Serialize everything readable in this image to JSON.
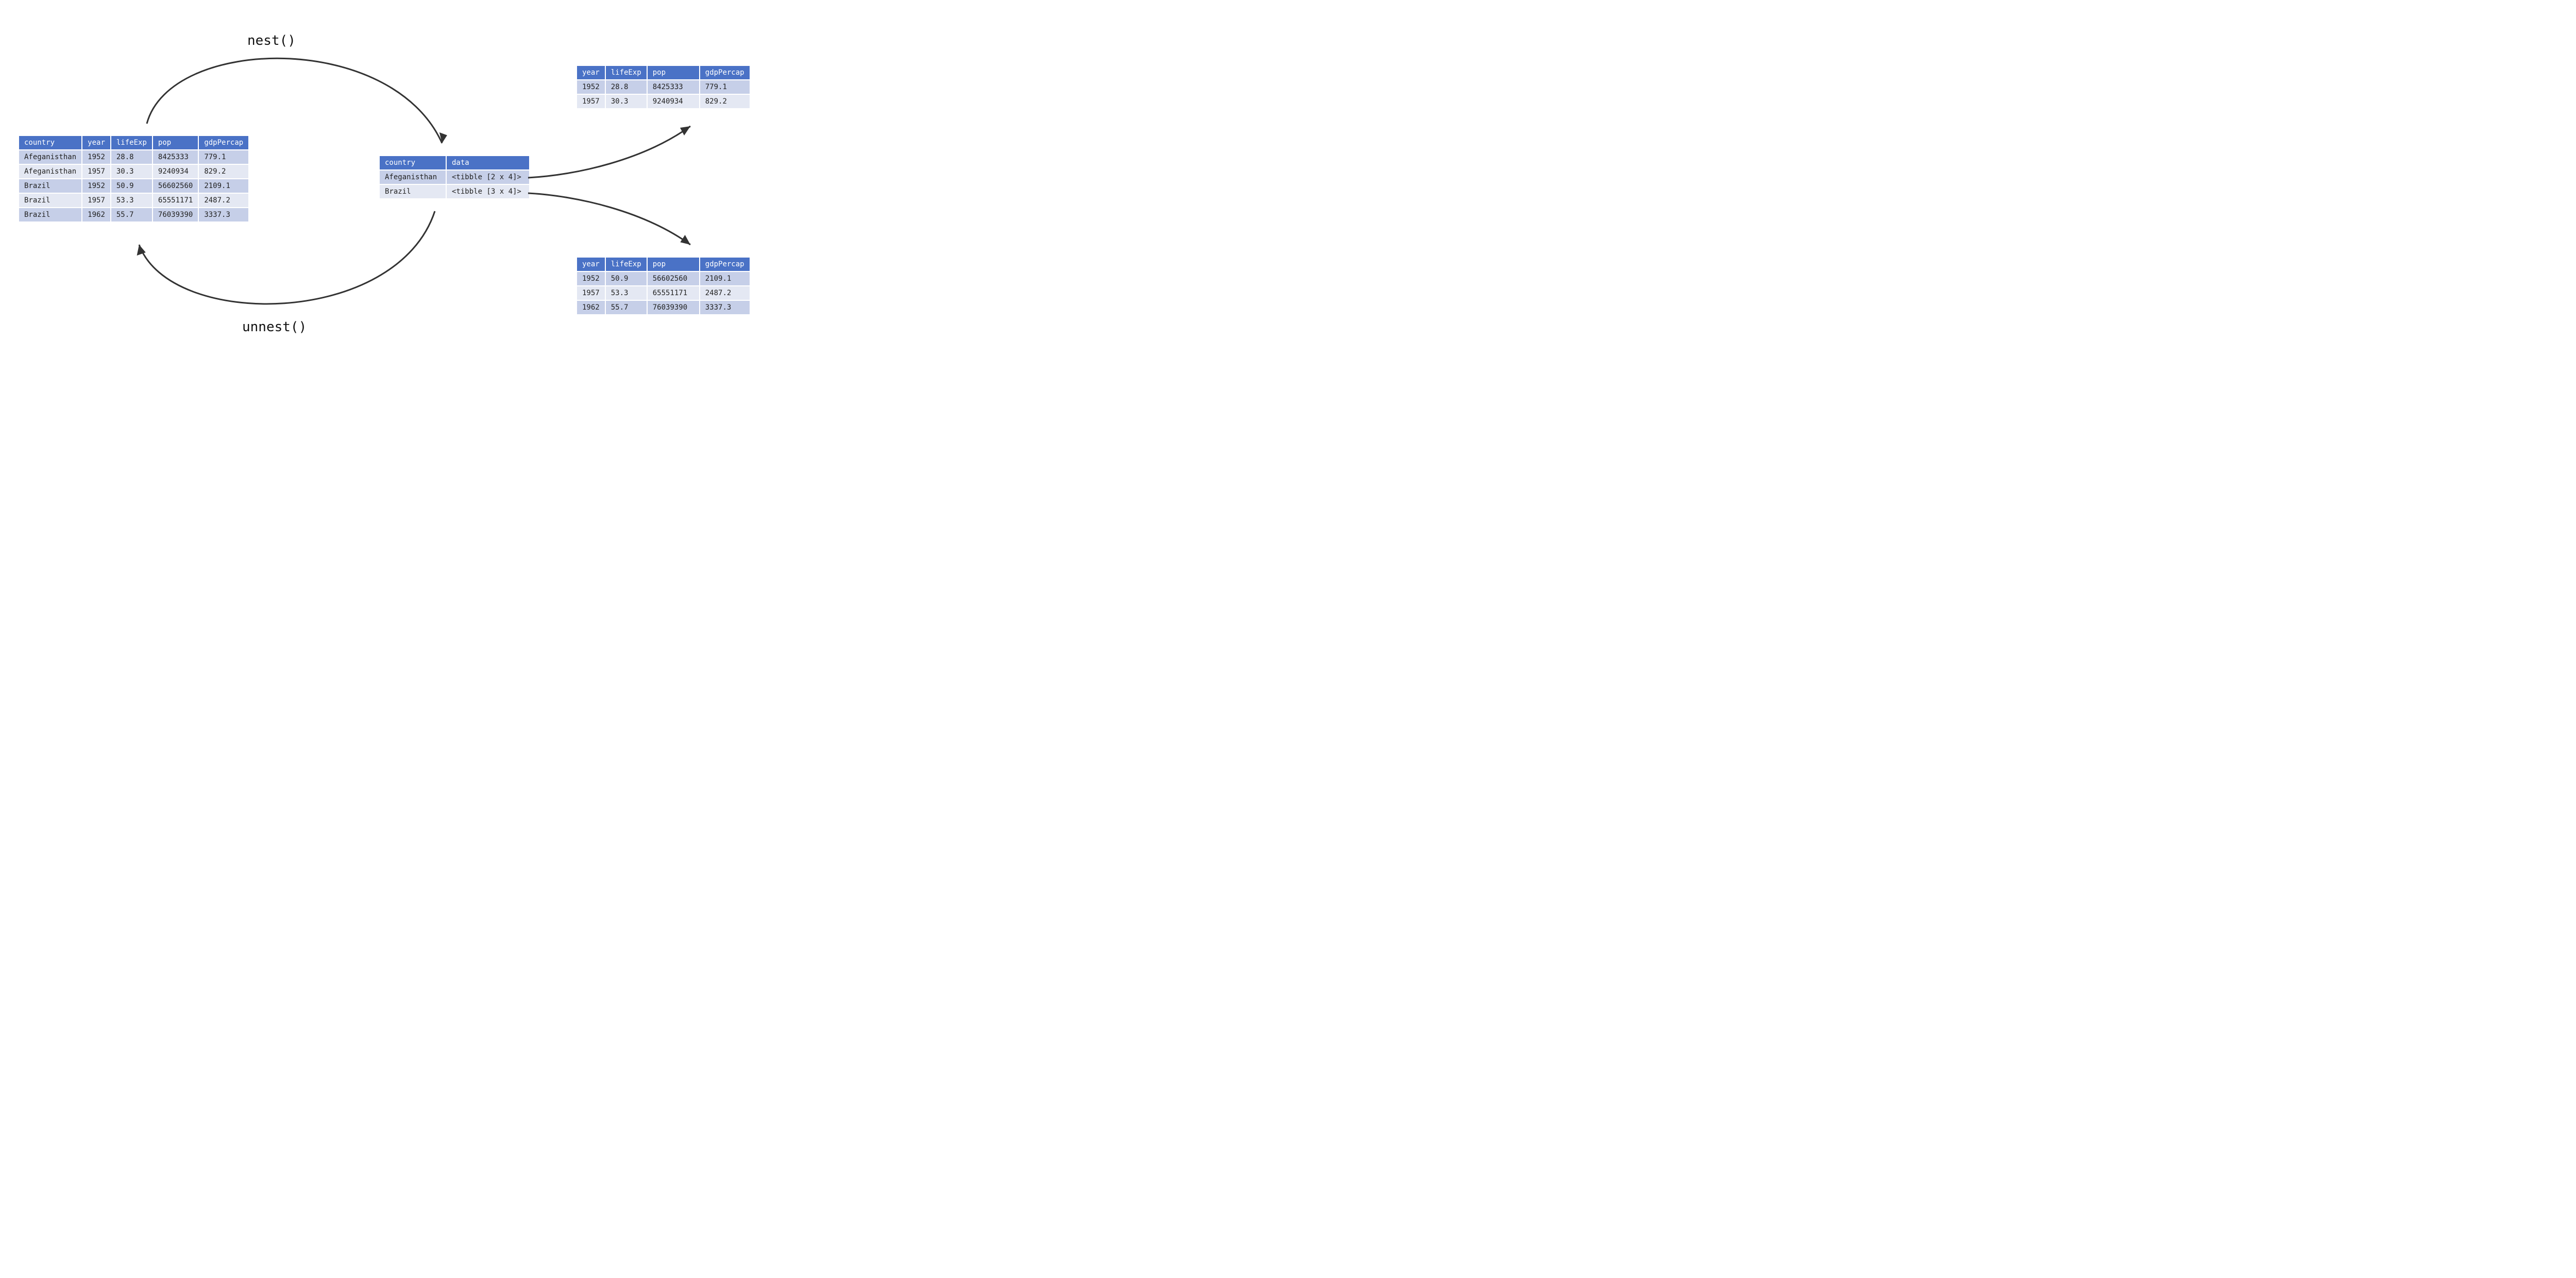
{
  "labels": {
    "nest": "nest()",
    "unnest": "unnest()"
  },
  "flatTable": {
    "headers": [
      "country",
      "year",
      "lifeExp",
      "pop",
      "gdpPercap"
    ],
    "rows": [
      [
        "Afeganisthan",
        "1952",
        "28.8",
        "8425333",
        "779.1"
      ],
      [
        "Afeganisthan",
        "1957",
        "30.3",
        "9240934",
        "829.2"
      ],
      [
        "Brazil",
        "1952",
        "50.9",
        "56602560",
        "2109.1"
      ],
      [
        "Brazil",
        "1957",
        "53.3",
        "65551171",
        "2487.2"
      ],
      [
        "Brazil",
        "1962",
        "55.7",
        "76039390",
        "3337.3"
      ]
    ]
  },
  "nestedTable": {
    "headers": [
      "country",
      "data"
    ],
    "rows": [
      [
        "Afeganisthan",
        "<tibble [2 x 4]>"
      ],
      [
        "Brazil",
        "<tibble [3 x 4]>"
      ]
    ]
  },
  "tibbleA": {
    "headers": [
      "year",
      "lifeExp",
      "pop",
      "gdpPercap"
    ],
    "rows": [
      [
        "1952",
        "28.8",
        "8425333",
        "779.1"
      ],
      [
        "1957",
        "30.3",
        "9240934",
        "829.2"
      ]
    ]
  },
  "tibbleB": {
    "headers": [
      "year",
      "lifeExp",
      "pop",
      "gdpPercap"
    ],
    "rows": [
      [
        "1952",
        "50.9",
        "56602560",
        "2109.1"
      ],
      [
        "1957",
        "53.3",
        "65551171",
        "2487.2"
      ],
      [
        "1962",
        "55.7",
        "76039390",
        "3337.3"
      ]
    ]
  }
}
